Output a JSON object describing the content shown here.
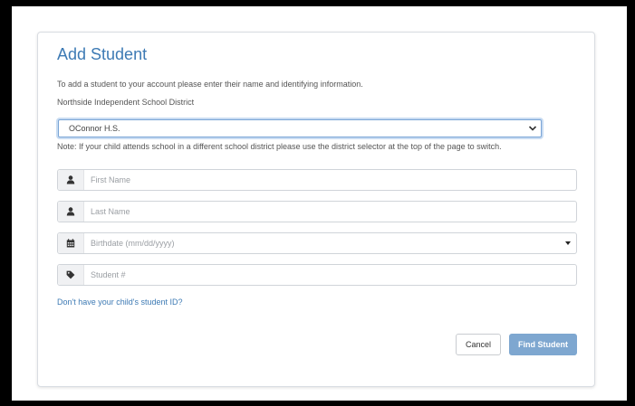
{
  "form": {
    "title": "Add Student",
    "intro": "To add a student to your account please enter their name and identifying information.",
    "district": "Northside Independent School District",
    "school_select": {
      "selected": "OConnor H.S."
    },
    "note": "Note: If your child attends school in a different school district please use the district selector at the top of the page to switch.",
    "fields": {
      "first_name": {
        "placeholder": "First Name",
        "icon": "user-icon"
      },
      "last_name": {
        "placeholder": "Last Name",
        "icon": "user-icon"
      },
      "birthdate": {
        "placeholder": "Birthdate (mm/dd/yyyy)",
        "icon": "calendar-icon"
      },
      "student_number": {
        "placeholder": "Student #",
        "icon": "tag-icon"
      }
    },
    "help_link": "Don't have your child's student ID?",
    "buttons": {
      "cancel": "Cancel",
      "find": "Find Student"
    }
  },
  "colors": {
    "accent": "#3d7ab4",
    "primary_button": "#7ea7d0",
    "frame": "#000000"
  }
}
